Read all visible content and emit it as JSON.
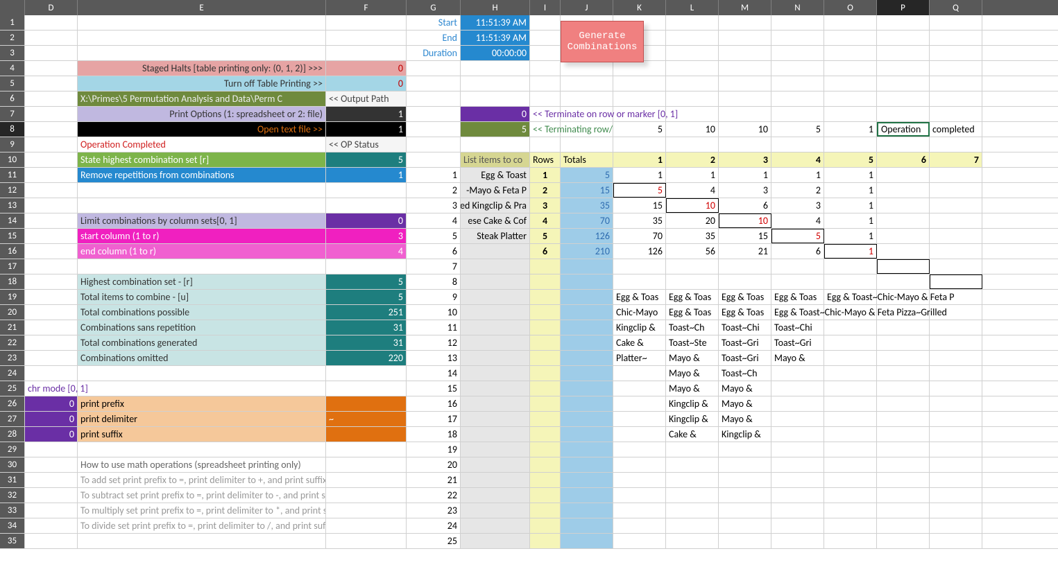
{
  "columns": [
    "D",
    "E",
    "F",
    "G",
    "H",
    "I",
    "J",
    "K",
    "L",
    "M",
    "N",
    "O",
    "P",
    "Q"
  ],
  "colWidths": {
    "D": 76,
    "E": 358,
    "F": 116,
    "G": 78,
    "H": 100,
    "I": 44,
    "J": 76,
    "K": 76,
    "L": 76,
    "M": 76,
    "N": 76,
    "O": 76,
    "P": 76,
    "Q": 76
  },
  "selectedCol": "P",
  "selectedRow": 8,
  "button": {
    "label": "Generate Combinations"
  },
  "cells": {
    "G1": {
      "t": "Start",
      "bg": "#ffffff",
      "fg": "#2e88d0",
      "align": "right"
    },
    "H1": {
      "t": "11:51:39 AM",
      "bg": "#2589cf",
      "fg": "#ffffff",
      "align": "right"
    },
    "G2": {
      "t": "End",
      "bg": "#ffffff",
      "fg": "#2e88d0",
      "align": "right"
    },
    "H2": {
      "t": "11:51:39 AM",
      "bg": "#2589cf",
      "fg": "#ffffff",
      "align": "right"
    },
    "G3": {
      "t": "Duration",
      "bg": "#ffffff",
      "fg": "#2e88d0",
      "align": "right"
    },
    "H3": {
      "t": "00:00:00",
      "bg": "#2589cf",
      "fg": "#ffffff",
      "align": "right"
    },
    "E4": {
      "t": "Staged Halts [table printing only: (0, 1, 2)]  >>>",
      "bg": "#e6a4a4",
      "fg": "#333",
      "align": "right"
    },
    "F4": {
      "t": "0",
      "bg": "#e6a4a4",
      "fg": "#c00000",
      "align": "right"
    },
    "E5": {
      "t": "Turn off Table Printing  >>",
      "bg": "#a4d6e6",
      "fg": "#333",
      "align": "right"
    },
    "F5": {
      "t": "0",
      "bg": "#a4d6e6",
      "fg": "#c00000",
      "align": "right"
    },
    "E6": {
      "t": "X:\\Primes\\5 Permutation Analysis and Data\\Perm C",
      "bg": "#6f8a3d",
      "fg": "#eee"
    },
    "F6": {
      "t": "<<  Output Path",
      "bg": "#f5f5f5",
      "fg": "#444"
    },
    "E7": {
      "t": "Print Options (1: spreadsheet or 2: file)",
      "bg": "#c0b8e0",
      "fg": "#333",
      "align": "right"
    },
    "F7": {
      "t": "1",
      "bg": "#333333",
      "fg": "#ffffff",
      "align": "right"
    },
    "H7": {
      "t": "0",
      "bg": "#6a2fa5",
      "fg": "#ffffff",
      "align": "right"
    },
    "I7": {
      "t": "<<  Terminate on row or marker [0, 1]",
      "fg": "#6a2fa5",
      "overflow": true
    },
    "E8": {
      "t": "Open text file  >>",
      "bg": "#000000",
      "fg": "#e07010",
      "align": "right"
    },
    "F8": {
      "t": "1",
      "bg": "#000000",
      "fg": "#ffffff",
      "align": "right"
    },
    "H8": {
      "t": "5",
      "bg": "#6f8a3d",
      "fg": "#ffffff",
      "align": "right"
    },
    "I8": {
      "t": "<<  Terminating row/",
      "fg": "#3f8a4d",
      "overflow": true
    },
    "K8": {
      "t": "5",
      "align": "right"
    },
    "L8": {
      "t": "10",
      "align": "right"
    },
    "M8": {
      "t": "10",
      "align": "right"
    },
    "N8": {
      "t": "5",
      "align": "right"
    },
    "O8": {
      "t": "1",
      "align": "right"
    },
    "P8": {
      "t": "Operation",
      "selected": true
    },
    "Q8": {
      "t": "completed"
    },
    "E9": {
      "t": "Operation Completed",
      "fg": "#d02020"
    },
    "F9": {
      "t": "<<  OP Status",
      "bg": "#f5f5f5",
      "fg": "#444"
    },
    "E10": {
      "t": "State highest combination set [r]",
      "bg": "#7db44a",
      "fg": "#ffffff"
    },
    "F10": {
      "t": "5",
      "bg": "#1e7e7e",
      "fg": "#ffffff",
      "align": "right"
    },
    "H10": {
      "t": "List items to co",
      "bg": "#d6d692",
      "fg": "#555"
    },
    "I10": {
      "t": "Rows",
      "bg": "#f5f5b8"
    },
    "J10": {
      "t": "Totals",
      "bg": "#f5f5b8"
    },
    "K10": {
      "t": "1",
      "bg": "#f5f5b8",
      "bold": true,
      "align": "right"
    },
    "L10": {
      "t": "2",
      "bg": "#f5f5b8",
      "bold": true,
      "align": "right"
    },
    "M10": {
      "t": "3",
      "bg": "#f5f5b8",
      "bold": true,
      "align": "right"
    },
    "N10": {
      "t": "4",
      "bg": "#f5f5b8",
      "bold": true,
      "align": "right"
    },
    "O10": {
      "t": "5",
      "bg": "#f5f5b8",
      "bold": true,
      "align": "right"
    },
    "P10": {
      "t": "6",
      "bg": "#f5f5b8",
      "bold": true,
      "align": "right"
    },
    "Q10": {
      "t": "7",
      "bg": "#f5f5b8",
      "bold": true,
      "align": "right"
    },
    "E11": {
      "t": "Remove repetitions from combinations",
      "bg": "#2589cf",
      "fg": "#ffffff"
    },
    "F11": {
      "t": "1",
      "bg": "#2589cf",
      "fg": "#ffffff",
      "align": "right"
    },
    "G11": {
      "t": "1",
      "align": "right"
    },
    "H11": {
      "t": "Egg & Toast",
      "bg": "#e6e6e6",
      "align": "right"
    },
    "I11": {
      "t": "1",
      "bg": "#f5f5b8",
      "bold": true,
      "align": "center"
    },
    "J11": {
      "t": "5",
      "bg": "#9ecce8",
      "fg": "#2e6cb0",
      "align": "right"
    },
    "K11": {
      "t": "1",
      "align": "right"
    },
    "L11": {
      "t": "1",
      "align": "right"
    },
    "M11": {
      "t": "1",
      "align": "right"
    },
    "N11": {
      "t": "1",
      "align": "right"
    },
    "O11": {
      "t": "1",
      "align": "right"
    },
    "G12": {
      "t": "2",
      "align": "right"
    },
    "H12": {
      "t": "-Mayo & Feta P",
      "bg": "#e6e6e6",
      "align": "right"
    },
    "I12": {
      "t": "2",
      "bg": "#f5f5b8",
      "bold": true,
      "align": "center"
    },
    "J12": {
      "t": "15",
      "bg": "#9ecce8",
      "fg": "#2e6cb0",
      "align": "right"
    },
    "K12": {
      "t": "5",
      "fg": "#d00000",
      "align": "right",
      "box": true
    },
    "L12": {
      "t": "4",
      "align": "right"
    },
    "M12": {
      "t": "3",
      "align": "right"
    },
    "N12": {
      "t": "2",
      "align": "right"
    },
    "O12": {
      "t": "1",
      "align": "right"
    },
    "G13": {
      "t": "3",
      "align": "right"
    },
    "H13": {
      "t": "ed Kingclip & Pra",
      "bg": "#e6e6e6",
      "align": "right"
    },
    "I13": {
      "t": "3",
      "bg": "#f5f5b8",
      "bold": true,
      "align": "center"
    },
    "J13": {
      "t": "35",
      "bg": "#9ecce8",
      "fg": "#2e6cb0",
      "align": "right"
    },
    "K13": {
      "t": "15",
      "align": "right"
    },
    "L13": {
      "t": "10",
      "fg": "#d00000",
      "align": "right",
      "box": true
    },
    "M13": {
      "t": "6",
      "align": "right"
    },
    "N13": {
      "t": "3",
      "align": "right"
    },
    "O13": {
      "t": "1",
      "align": "right"
    },
    "E14": {
      "t": "Limit combinations by column sets[0, 1]",
      "bg": "#c0b8e0",
      "fg": "#333"
    },
    "F14": {
      "t": "0",
      "bg": "#6a2fa5",
      "fg": "#ffffff",
      "align": "right"
    },
    "G14": {
      "t": "4",
      "align": "right"
    },
    "H14": {
      "t": "ese Cake & Cof",
      "bg": "#e6e6e6",
      "align": "right"
    },
    "I14": {
      "t": "4",
      "bg": "#f5f5b8",
      "bold": true,
      "align": "center"
    },
    "J14": {
      "t": "70",
      "bg": "#9ecce8",
      "fg": "#2e6cb0",
      "align": "right"
    },
    "K14": {
      "t": "35",
      "align": "right"
    },
    "L14": {
      "t": "20",
      "align": "right"
    },
    "M14": {
      "t": "10",
      "fg": "#d00000",
      "align": "right",
      "box": true
    },
    "N14": {
      "t": "4",
      "align": "right"
    },
    "O14": {
      "t": "1",
      "align": "right"
    },
    "E15": {
      "t": "start column (1 to r)",
      "bg": "#f020c0",
      "fg": "#ffffff"
    },
    "F15": {
      "t": "3",
      "bg": "#f020c0",
      "fg": "#ffffff",
      "align": "right"
    },
    "G15": {
      "t": "5",
      "align": "right"
    },
    "H15": {
      "t": "Steak Platter",
      "bg": "#e6e6e6",
      "align": "right"
    },
    "I15": {
      "t": "5",
      "bg": "#f5f5b8",
      "bold": true,
      "align": "center"
    },
    "J15": {
      "t": "126",
      "bg": "#9ecce8",
      "fg": "#2e6cb0",
      "align": "right"
    },
    "K15": {
      "t": "70",
      "align": "right"
    },
    "L15": {
      "t": "35",
      "align": "right"
    },
    "M15": {
      "t": "15",
      "align": "right"
    },
    "N15": {
      "t": "5",
      "fg": "#d00000",
      "align": "right",
      "box": true
    },
    "O15": {
      "t": "1",
      "align": "right"
    },
    "E16": {
      "t": "end column (1 to r)",
      "bg": "#f060d0",
      "fg": "#ffffff"
    },
    "F16": {
      "t": "4",
      "bg": "#f060d0",
      "fg": "#ffffff",
      "align": "right"
    },
    "G16": {
      "t": "6",
      "align": "right"
    },
    "H16": {
      "t": "",
      "bg": "#e6e6e6"
    },
    "I16": {
      "t": "6",
      "bg": "#f5f5b8",
      "bold": true,
      "align": "center"
    },
    "J16": {
      "t": "210",
      "bg": "#9ecce8",
      "fg": "#2e6cb0",
      "align": "right"
    },
    "K16": {
      "t": "126",
      "align": "right"
    },
    "L16": {
      "t": "56",
      "align": "right"
    },
    "M16": {
      "t": "21",
      "align": "right"
    },
    "N16": {
      "t": "6",
      "align": "right"
    },
    "O16": {
      "t": "1",
      "fg": "#d00000",
      "align": "right",
      "box": true
    },
    "G17": {
      "t": "7",
      "align": "right"
    },
    "H17": {
      "t": "",
      "bg": "#e6e6e6"
    },
    "I17": {
      "t": "",
      "bg": "#f5f5b8"
    },
    "J17": {
      "t": "",
      "bg": "#9ecce8"
    },
    "P17": {
      "t": "",
      "box": true
    },
    "E18": {
      "t": "Highest combination set - [r]",
      "bg": "#c8e4e4",
      "fg": "#333"
    },
    "F18": {
      "t": "5",
      "bg": "#1e7e7e",
      "fg": "#ffffff",
      "align": "right"
    },
    "G18": {
      "t": "8",
      "align": "right"
    },
    "H18": {
      "t": "",
      "bg": "#e6e6e6"
    },
    "I18": {
      "t": "",
      "bg": "#f5f5b8"
    },
    "J18": {
      "t": "",
      "bg": "#9ecce8"
    },
    "Q18": {
      "t": "",
      "box": true
    },
    "E19": {
      "t": "Total items to combine - [u]",
      "bg": "#c8e4e4",
      "fg": "#333"
    },
    "F19": {
      "t": "5",
      "bg": "#1e7e7e",
      "fg": "#ffffff",
      "align": "right"
    },
    "G19": {
      "t": "9",
      "align": "right"
    },
    "H19": {
      "t": "",
      "bg": "#e6e6e6"
    },
    "I19": {
      "t": "",
      "bg": "#f5f5b8"
    },
    "J19": {
      "t": "",
      "bg": "#9ecce8"
    },
    "K19": {
      "t": "Egg & Toas"
    },
    "L19": {
      "t": "Egg & Toas"
    },
    "M19": {
      "t": "Egg & Toas"
    },
    "N19": {
      "t": "Egg & Toas"
    },
    "O19": {
      "t": "Egg & Toast~Chic-Mayo & Feta P",
      "overflow": true
    },
    "E20": {
      "t": "Total combinations possible",
      "bg": "#c8e4e4",
      "fg": "#333"
    },
    "F20": {
      "t": "251",
      "bg": "#1e7e7e",
      "fg": "#ffffff",
      "align": "right"
    },
    "G20": {
      "t": "10",
      "align": "right"
    },
    "H20": {
      "t": "",
      "bg": "#e6e6e6"
    },
    "I20": {
      "t": "",
      "bg": "#f5f5b8"
    },
    "J20": {
      "t": "",
      "bg": "#9ecce8"
    },
    "K20": {
      "t": "Chic-Mayo"
    },
    "L20": {
      "t": "Egg & Toas"
    },
    "M20": {
      "t": "Egg & Toas"
    },
    "N20": {
      "t": "Egg & Toast~Chic-Mayo & Feta Pizza~Grilled",
      "overflow": true
    },
    "E21": {
      "t": "Combinations sans repetition",
      "bg": "#c8e4e4",
      "fg": "#333"
    },
    "F21": {
      "t": "31",
      "bg": "#1e7e7e",
      "fg": "#ffffff",
      "align": "right"
    },
    "G21": {
      "t": "11",
      "align": "right"
    },
    "H21": {
      "t": "",
      "bg": "#e6e6e6"
    },
    "I21": {
      "t": "",
      "bg": "#f5f5b8"
    },
    "J21": {
      "t": "",
      "bg": "#9ecce8"
    },
    "K21": {
      "t": "Kingclip &"
    },
    "L21": {
      "t": "Toast~Ch"
    },
    "M21": {
      "t": "Toast~Chi"
    },
    "N21": {
      "t": "Toast~Chi"
    },
    "E22": {
      "t": "Total combinations generated",
      "bg": "#c8e4e4",
      "fg": "#333"
    },
    "F22": {
      "t": "31",
      "bg": "#1e7e7e",
      "fg": "#ffffff",
      "align": "right"
    },
    "G22": {
      "t": "12",
      "align": "right"
    },
    "H22": {
      "t": "",
      "bg": "#e6e6e6"
    },
    "I22": {
      "t": "",
      "bg": "#f5f5b8"
    },
    "J22": {
      "t": "",
      "bg": "#9ecce8"
    },
    "K22": {
      "t": "Cake &"
    },
    "L22": {
      "t": "Toast~Ste"
    },
    "M22": {
      "t": "Toast~Gri"
    },
    "N22": {
      "t": "Toast~Gri"
    },
    "E23": {
      "t": "Combinations omitted",
      "bg": "#c8e4e4",
      "fg": "#333"
    },
    "F23": {
      "t": "220",
      "bg": "#1e7e7e",
      "fg": "#ffffff",
      "align": "right"
    },
    "G23": {
      "t": "13",
      "align": "right"
    },
    "H23": {
      "t": "",
      "bg": "#e6e6e6"
    },
    "I23": {
      "t": "",
      "bg": "#f5f5b8"
    },
    "J23": {
      "t": "",
      "bg": "#9ecce8"
    },
    "K23": {
      "t": "Platter~"
    },
    "L23": {
      "t": "Mayo &"
    },
    "M23": {
      "t": "Toast~Gri"
    },
    "N23": {
      "t": "Mayo &"
    },
    "G24": {
      "t": "14",
      "align": "right"
    },
    "H24": {
      "t": "",
      "bg": "#e6e6e6"
    },
    "I24": {
      "t": "",
      "bg": "#f5f5b8"
    },
    "J24": {
      "t": "",
      "bg": "#9ecce8"
    },
    "L24": {
      "t": "Mayo &"
    },
    "M24": {
      "t": "Toast~Ch"
    },
    "D25": {
      "t": "chr mode [0, 1]",
      "fg": "#6a2fa5",
      "overflow": true
    },
    "G25": {
      "t": "15",
      "align": "right"
    },
    "H25": {
      "t": "",
      "bg": "#e6e6e6"
    },
    "I25": {
      "t": "",
      "bg": "#f5f5b8"
    },
    "J25": {
      "t": "",
      "bg": "#9ecce8"
    },
    "L25": {
      "t": "Mayo &"
    },
    "M25": {
      "t": "Mayo &"
    },
    "D26": {
      "t": "0",
      "bg": "#6a2fa5",
      "fg": "#ffffff",
      "align": "right"
    },
    "E26": {
      "t": "print prefix",
      "bg": "#f5c89a"
    },
    "F26": {
      "t": "",
      "bg": "#e07010"
    },
    "G26": {
      "t": "16",
      "align": "right"
    },
    "H26": {
      "t": "",
      "bg": "#e6e6e6"
    },
    "I26": {
      "t": "",
      "bg": "#f5f5b8"
    },
    "J26": {
      "t": "",
      "bg": "#9ecce8"
    },
    "L26": {
      "t": "Kingclip &"
    },
    "M26": {
      "t": "Mayo &"
    },
    "D27": {
      "t": "0",
      "bg": "#6a2fa5",
      "fg": "#ffffff",
      "align": "right"
    },
    "E27": {
      "t": "print delimiter",
      "bg": "#f5c89a"
    },
    "F27": {
      "t": "~",
      "bg": "#e07010",
      "fg": "#ffffff"
    },
    "G27": {
      "t": "17",
      "align": "right"
    },
    "H27": {
      "t": "",
      "bg": "#e6e6e6"
    },
    "I27": {
      "t": "",
      "bg": "#f5f5b8"
    },
    "J27": {
      "t": "",
      "bg": "#9ecce8"
    },
    "L27": {
      "t": "Kingclip &"
    },
    "M27": {
      "t": "Mayo &"
    },
    "D28": {
      "t": "0",
      "bg": "#6a2fa5",
      "fg": "#ffffff",
      "align": "right"
    },
    "E28": {
      "t": "print suffix",
      "bg": "#f5c89a"
    },
    "F28": {
      "t": "",
      "bg": "#e07010"
    },
    "G28": {
      "t": "18",
      "align": "right"
    },
    "H28": {
      "t": "",
      "bg": "#e6e6e6"
    },
    "I28": {
      "t": "",
      "bg": "#f5f5b8"
    },
    "J28": {
      "t": "",
      "bg": "#9ecce8"
    },
    "L28": {
      "t": "Cake &"
    },
    "M28": {
      "t": "Kingclip &"
    },
    "G29": {
      "t": "19",
      "align": "right"
    },
    "H29": {
      "t": "",
      "bg": "#e6e6e6"
    },
    "I29": {
      "t": "",
      "bg": "#f5f5b8"
    },
    "J29": {
      "t": "",
      "bg": "#9ecce8"
    },
    "E30": {
      "t": "How to use math operations (spreadsheet printing only)",
      "fg": "#666"
    },
    "G30": {
      "t": "20",
      "align": "right"
    },
    "H30": {
      "t": "",
      "bg": "#e6e6e6"
    },
    "I30": {
      "t": "",
      "bg": "#f5f5b8"
    },
    "J30": {
      "t": "",
      "bg": "#9ecce8"
    },
    "E31": {
      "t": "   To add set print prefix to =, print delimiter to +, and print suffix to",
      "fg": "#999"
    },
    "G31": {
      "t": "21",
      "align": "right"
    },
    "H31": {
      "t": "",
      "bg": "#e6e6e6"
    },
    "I31": {
      "t": "",
      "bg": "#f5f5b8"
    },
    "J31": {
      "t": "",
      "bg": "#9ecce8"
    },
    "E32": {
      "t": "   To subtract set print prefix to =, print delimiter to -, and print suffi",
      "fg": "#999"
    },
    "G32": {
      "t": "22",
      "align": "right"
    },
    "H32": {
      "t": "",
      "bg": "#e6e6e6"
    },
    "I32": {
      "t": "",
      "bg": "#f5f5b8"
    },
    "J32": {
      "t": "",
      "bg": "#9ecce8"
    },
    "E33": {
      "t": "   To multiply set print prefix to =, print delimiter to *, and print suffi",
      "fg": "#999"
    },
    "G33": {
      "t": "23",
      "align": "right"
    },
    "H33": {
      "t": "",
      "bg": "#e6e6e6"
    },
    "I33": {
      "t": "",
      "bg": "#f5f5b8"
    },
    "J33": {
      "t": "",
      "bg": "#9ecce8"
    },
    "E34": {
      "t": "   To divide set print prefix to =, print delimiter to /, and print suffix t",
      "fg": "#999"
    },
    "G34": {
      "t": "24",
      "align": "right"
    },
    "H34": {
      "t": "",
      "bg": "#e6e6e6"
    },
    "I34": {
      "t": "",
      "bg": "#f5f5b8"
    },
    "J34": {
      "t": "",
      "bg": "#9ecce8"
    },
    "G35": {
      "t": "25",
      "align": "right"
    },
    "H35": {
      "t": "",
      "bg": "#e6e6e6"
    },
    "I35": {
      "t": "",
      "bg": "#f5f5b8"
    },
    "J35": {
      "t": "",
      "bg": "#9ecce8"
    }
  },
  "rowCount": 35
}
